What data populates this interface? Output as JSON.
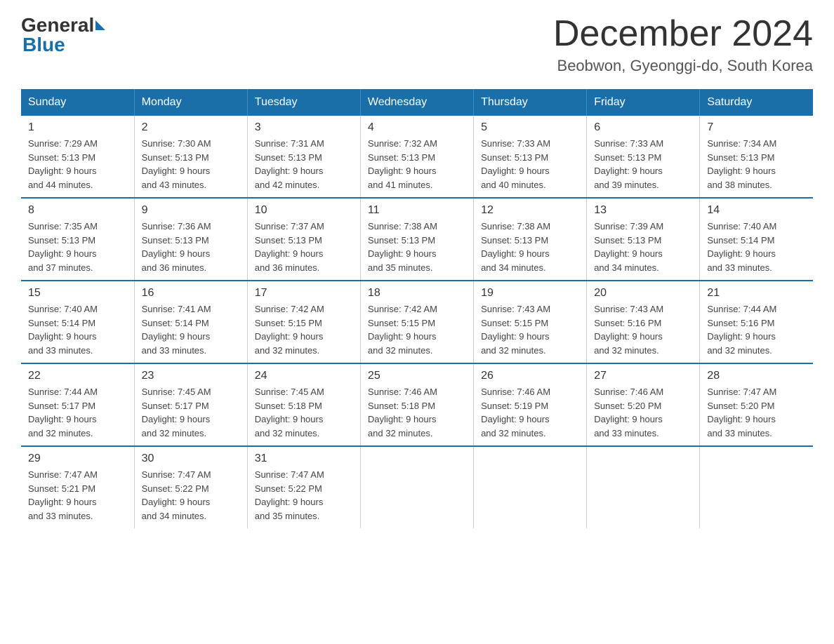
{
  "header": {
    "logo_general": "General",
    "logo_blue": "Blue",
    "title": "December 2024",
    "subtitle": "Beobwon, Gyeonggi-do, South Korea"
  },
  "days_of_week": [
    "Sunday",
    "Monday",
    "Tuesday",
    "Wednesday",
    "Thursday",
    "Friday",
    "Saturday"
  ],
  "weeks": [
    [
      {
        "day": "1",
        "sunrise": "7:29 AM",
        "sunset": "5:13 PM",
        "daylight": "9 hours and 44 minutes."
      },
      {
        "day": "2",
        "sunrise": "7:30 AM",
        "sunset": "5:13 PM",
        "daylight": "9 hours and 43 minutes."
      },
      {
        "day": "3",
        "sunrise": "7:31 AM",
        "sunset": "5:13 PM",
        "daylight": "9 hours and 42 minutes."
      },
      {
        "day": "4",
        "sunrise": "7:32 AM",
        "sunset": "5:13 PM",
        "daylight": "9 hours and 41 minutes."
      },
      {
        "day": "5",
        "sunrise": "7:33 AM",
        "sunset": "5:13 PM",
        "daylight": "9 hours and 40 minutes."
      },
      {
        "day": "6",
        "sunrise": "7:33 AM",
        "sunset": "5:13 PM",
        "daylight": "9 hours and 39 minutes."
      },
      {
        "day": "7",
        "sunrise": "7:34 AM",
        "sunset": "5:13 PM",
        "daylight": "9 hours and 38 minutes."
      }
    ],
    [
      {
        "day": "8",
        "sunrise": "7:35 AM",
        "sunset": "5:13 PM",
        "daylight": "9 hours and 37 minutes."
      },
      {
        "day": "9",
        "sunrise": "7:36 AM",
        "sunset": "5:13 PM",
        "daylight": "9 hours and 36 minutes."
      },
      {
        "day": "10",
        "sunrise": "7:37 AM",
        "sunset": "5:13 PM",
        "daylight": "9 hours and 36 minutes."
      },
      {
        "day": "11",
        "sunrise": "7:38 AM",
        "sunset": "5:13 PM",
        "daylight": "9 hours and 35 minutes."
      },
      {
        "day": "12",
        "sunrise": "7:38 AM",
        "sunset": "5:13 PM",
        "daylight": "9 hours and 34 minutes."
      },
      {
        "day": "13",
        "sunrise": "7:39 AM",
        "sunset": "5:13 PM",
        "daylight": "9 hours and 34 minutes."
      },
      {
        "day": "14",
        "sunrise": "7:40 AM",
        "sunset": "5:14 PM",
        "daylight": "9 hours and 33 minutes."
      }
    ],
    [
      {
        "day": "15",
        "sunrise": "7:40 AM",
        "sunset": "5:14 PM",
        "daylight": "9 hours and 33 minutes."
      },
      {
        "day": "16",
        "sunrise": "7:41 AM",
        "sunset": "5:14 PM",
        "daylight": "9 hours and 33 minutes."
      },
      {
        "day": "17",
        "sunrise": "7:42 AM",
        "sunset": "5:15 PM",
        "daylight": "9 hours and 32 minutes."
      },
      {
        "day": "18",
        "sunrise": "7:42 AM",
        "sunset": "5:15 PM",
        "daylight": "9 hours and 32 minutes."
      },
      {
        "day": "19",
        "sunrise": "7:43 AM",
        "sunset": "5:15 PM",
        "daylight": "9 hours and 32 minutes."
      },
      {
        "day": "20",
        "sunrise": "7:43 AM",
        "sunset": "5:16 PM",
        "daylight": "9 hours and 32 minutes."
      },
      {
        "day": "21",
        "sunrise": "7:44 AM",
        "sunset": "5:16 PM",
        "daylight": "9 hours and 32 minutes."
      }
    ],
    [
      {
        "day": "22",
        "sunrise": "7:44 AM",
        "sunset": "5:17 PM",
        "daylight": "9 hours and 32 minutes."
      },
      {
        "day": "23",
        "sunrise": "7:45 AM",
        "sunset": "5:17 PM",
        "daylight": "9 hours and 32 minutes."
      },
      {
        "day": "24",
        "sunrise": "7:45 AM",
        "sunset": "5:18 PM",
        "daylight": "9 hours and 32 minutes."
      },
      {
        "day": "25",
        "sunrise": "7:46 AM",
        "sunset": "5:18 PM",
        "daylight": "9 hours and 32 minutes."
      },
      {
        "day": "26",
        "sunrise": "7:46 AM",
        "sunset": "5:19 PM",
        "daylight": "9 hours and 32 minutes."
      },
      {
        "day": "27",
        "sunrise": "7:46 AM",
        "sunset": "5:20 PM",
        "daylight": "9 hours and 33 minutes."
      },
      {
        "day": "28",
        "sunrise": "7:47 AM",
        "sunset": "5:20 PM",
        "daylight": "9 hours and 33 minutes."
      }
    ],
    [
      {
        "day": "29",
        "sunrise": "7:47 AM",
        "sunset": "5:21 PM",
        "daylight": "9 hours and 33 minutes."
      },
      {
        "day": "30",
        "sunrise": "7:47 AM",
        "sunset": "5:22 PM",
        "daylight": "9 hours and 34 minutes."
      },
      {
        "day": "31",
        "sunrise": "7:47 AM",
        "sunset": "5:22 PM",
        "daylight": "9 hours and 35 minutes."
      },
      null,
      null,
      null,
      null
    ]
  ],
  "labels": {
    "sunrise": "Sunrise:",
    "sunset": "Sunset:",
    "daylight": "Daylight:"
  }
}
